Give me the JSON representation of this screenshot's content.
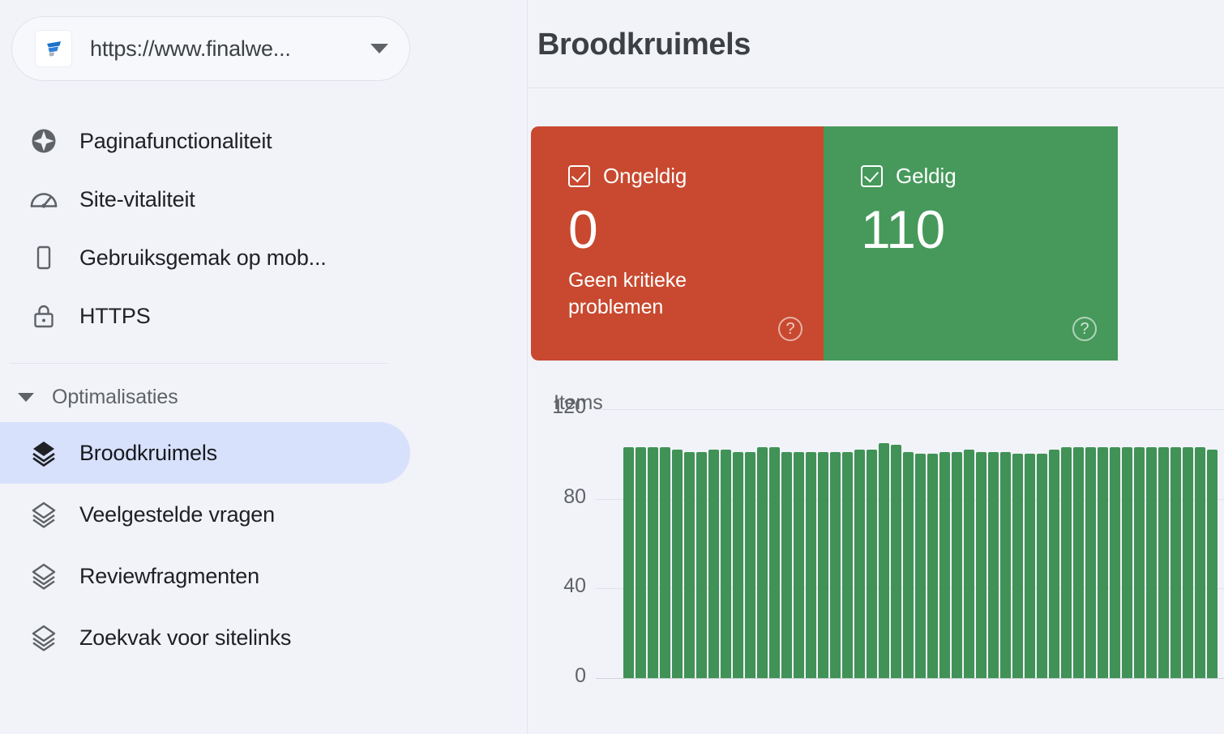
{
  "sidebar": {
    "property": {
      "url_label": "https://www.finalwe...",
      "favicon_name": "site-favicon",
      "caret_name": "chevron-down-icon"
    },
    "items": [
      {
        "label": "Paginafunctionaliteit",
        "icon": "page-experience-icon"
      },
      {
        "label": "Site-vitaliteit",
        "icon": "speedometer-icon"
      },
      {
        "label": "Gebruiksgemak op mob...",
        "icon": "mobile-phone-icon"
      },
      {
        "label": "HTTPS",
        "icon": "lock-icon"
      }
    ],
    "group": {
      "label": "Optimalisaties",
      "caret_icon": "chevron-down-icon",
      "items": [
        {
          "label": "Broodkruimels",
          "icon": "layers-icon",
          "selected": true
        },
        {
          "label": "Veelgestelde vragen",
          "icon": "layers-icon",
          "selected": false
        },
        {
          "label": "Reviewfragmenten",
          "icon": "layers-icon",
          "selected": false
        },
        {
          "label": "Zoekvak voor sitelinks",
          "icon": "layers-icon",
          "selected": false
        }
      ]
    }
  },
  "main": {
    "title": "Broodkruimels",
    "cards": [
      {
        "status": "invalid",
        "label": "Ongeldig",
        "value": "0",
        "subtitle": "Geen kritieke problemen",
        "color": "#c8492f",
        "checkbox_icon": "checkbox-checked-icon",
        "help_icon": "help-circle-icon",
        "help_glyph": "?"
      },
      {
        "status": "valid",
        "label": "Geldig",
        "value": "110",
        "subtitle": "",
        "color": "#46995b",
        "checkbox_icon": "checkbox-checked-icon",
        "help_icon": "help-circle-icon",
        "help_glyph": "?"
      }
    ]
  },
  "chart_data": {
    "type": "bar",
    "title": "",
    "xlabel": "",
    "ylabel": "Items",
    "ylim": [
      0,
      120
    ],
    "yticks": [
      120,
      80,
      40,
      0
    ],
    "grid": true,
    "legend": null,
    "series_color": "#409256",
    "series": [
      {
        "name": "Geldig",
        "values": [
          103,
          103,
          103,
          103,
          102,
          101,
          101,
          102,
          102,
          101,
          101,
          103,
          103,
          101,
          101,
          101,
          101,
          101,
          101,
          102,
          102,
          105,
          104,
          101,
          100,
          100,
          101,
          101,
          102,
          101,
          101,
          101,
          100,
          100,
          100,
          102,
          103,
          103,
          103,
          103,
          103,
          103,
          103,
          103,
          103,
          103,
          103,
          103,
          102
        ]
      }
    ],
    "note": "Daily count of valid breadcrumb items; x-axis date labels are cropped out of the viewport, chart continues past the right edge"
  },
  "colors": {
    "page_background": "#f1f3f8",
    "invalid": "#c8492f",
    "valid": "#46995b",
    "bar": "#409256",
    "selected_nav": "#d8e1fc"
  }
}
